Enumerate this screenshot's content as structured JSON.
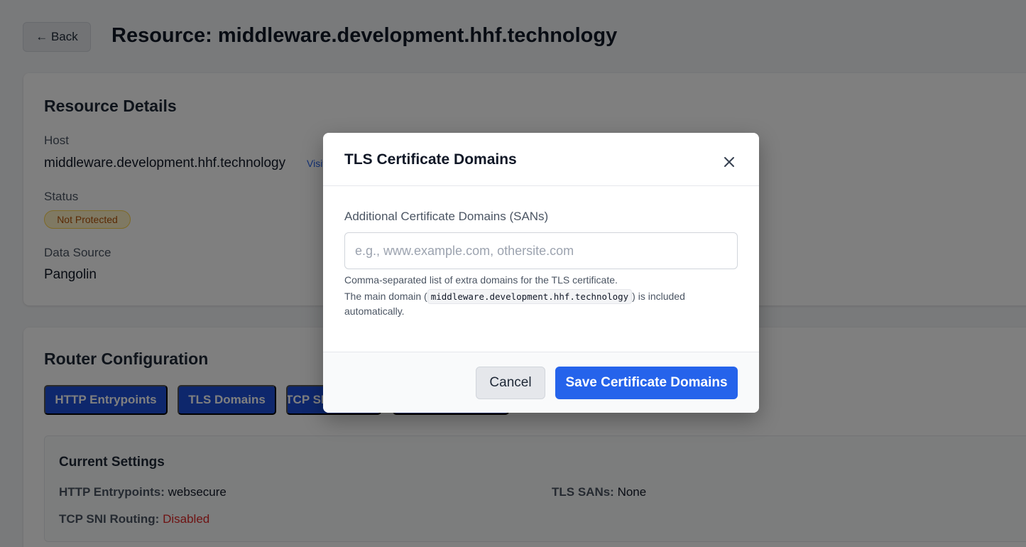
{
  "header": {
    "back_label": "← Back",
    "title": "Resource: middleware.development.hhf.technology"
  },
  "details": {
    "title": "Resource Details",
    "host_label": "Host",
    "host_value": "middleware.development.hhf.technology",
    "visit_link": "Visit",
    "status_label": "Status",
    "status_badge": "Not Protected",
    "source_label": "Data Source",
    "source_value": "Pangolin"
  },
  "router": {
    "title": "Router Configuration",
    "tabs": [
      {
        "label": "HTTP Entrypoints"
      },
      {
        "label": "TLS Domains"
      },
      {
        "label": "TCP SNI Routing"
      },
      {
        "label": ""
      }
    ],
    "settings": {
      "title": "Current Settings",
      "http_key": "HTTP Entrypoints:",
      "http_value": "websecure",
      "tls_key": "TLS SANs:",
      "tls_value": "None",
      "tcp_key": "TCP SNI Routing:",
      "tcp_value": "Disabled"
    }
  },
  "modal": {
    "title": "TLS Certificate Domains",
    "close_icon": "close-icon",
    "field_label": "Additional Certificate Domains (SANs)",
    "input_value": "",
    "input_placeholder": "e.g., www.example.com, othersite.com",
    "help_line1": "Comma-separated list of extra domains for the TLS certificate.",
    "help_line2_prefix": "The main domain (",
    "help_line2_code": "middleware.development.hhf.technology",
    "help_line2_suffix": ") is included",
    "help_line3": "automatically.",
    "cancel_label": "Cancel",
    "save_label": "Save Certificate Domains"
  },
  "colors": {
    "primary": "#2563eb",
    "tab_blue": "#1d4ed8",
    "warning": "#b45309",
    "danger": "#dc2626"
  }
}
